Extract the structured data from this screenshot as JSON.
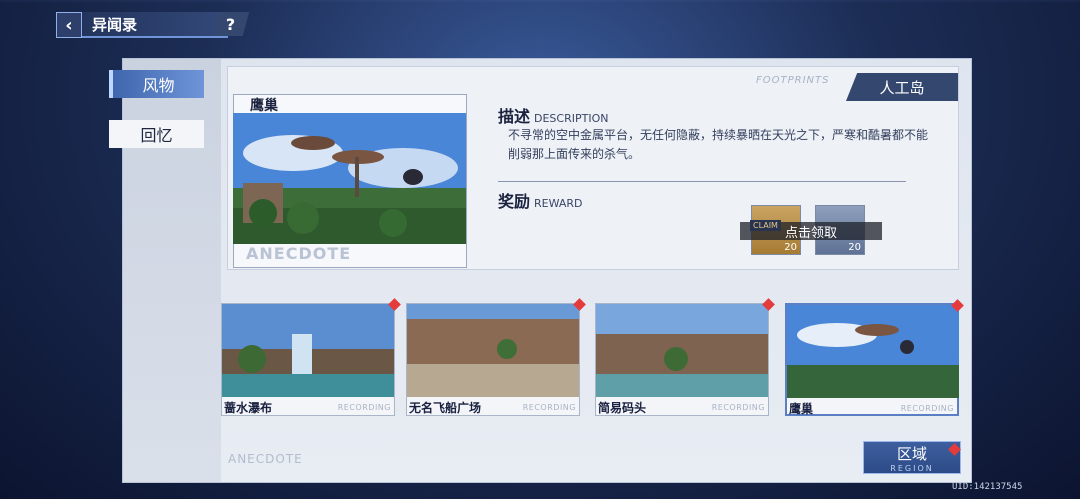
{
  "header": {
    "title": "异闻录",
    "back_icon": "chevron-left-icon",
    "help_label": "?"
  },
  "categories": [
    {
      "label": "风物",
      "active": true
    },
    {
      "label": "回忆",
      "active": false
    }
  ],
  "detail": {
    "region_tag": "人工岛",
    "footprints_label": "FOOTPRINTS",
    "scene_name": "鹰巢",
    "watermark": "ANECDOTE",
    "description_title": "描述",
    "description_sub": "DESCRIPTION",
    "description_text": "不寻常的空中金属平台，无任何隐蔽，持续暴晒在天光之下，严寒和酷暑都不能削弱那上面传来的杀气。",
    "reward_title": "奖励",
    "reward_sub": "REWARD",
    "rewards": [
      {
        "count": "20",
        "tag": "CLAIM"
      },
      {
        "count": "20"
      }
    ],
    "claim_label": "点击领取"
  },
  "scenery": [
    {
      "name": "蔷水瀑布",
      "rec": "RECORDING"
    },
    {
      "name": "无名飞船广场",
      "rec": "RECORDING"
    },
    {
      "name": "简易码头",
      "rec": "RECORDING"
    },
    {
      "name": "鹰巢",
      "rec": "RECORDING"
    }
  ],
  "footer": {
    "anecdote": "ANECDOTE",
    "region_cn": "区域",
    "region_en": "REGION",
    "uid": "UID:142137545"
  },
  "colors": {
    "accent": "#3f66ae",
    "badge": "#e43b3b",
    "panel": "#e8ecf3"
  }
}
